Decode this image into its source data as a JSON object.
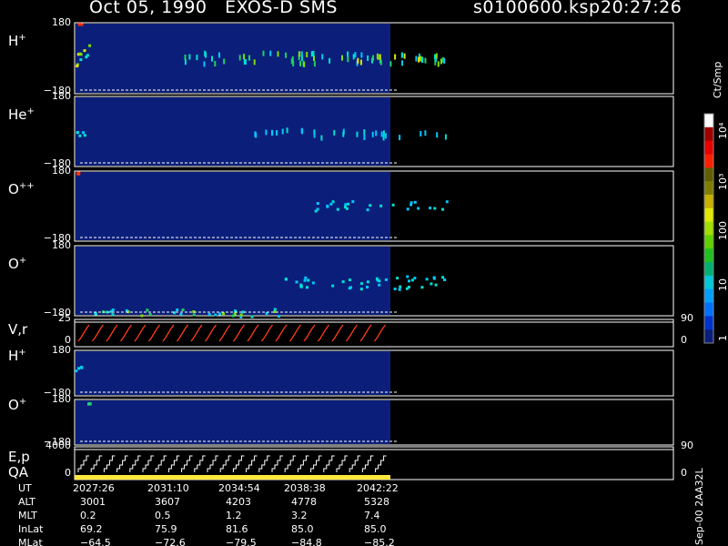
{
  "header": {
    "title": "Oct 05, 1990   EXOS-D SMS",
    "file": "s0100600.ksp",
    "time": "20:27:26"
  },
  "colors": {
    "background": "#000000",
    "panel_fill": "#0b1f7a",
    "dashed_line": "#ffffff",
    "velocity_trace": "#ff3a1a",
    "energy_trace": "#ffffff",
    "qa_bar": "#ffe83a"
  },
  "colorbar": {
    "unit_label": "Ct/Smp",
    "tick_labels": [
      "1",
      "10",
      "100",
      "10³",
      "10⁴"
    ],
    "colors": [
      "#0b1f7a",
      "#0033cc",
      "#0070ff",
      "#00a0ff",
      "#00c8d8",
      "#00b070",
      "#20c020",
      "#60d000",
      "#a0e000",
      "#e0e800",
      "#c8b000",
      "#808000",
      "#606000",
      "#ff2000",
      "#e80000",
      "#a00000",
      "#ffffff"
    ]
  },
  "side_label": "Sep-00 2AA32L",
  "chart_data": {
    "type": "heatmap",
    "title": "Oct 05, 1990   EXOS-D SMS",
    "time_axis_labels": [
      "2027:26",
      "2031:10",
      "2034:54",
      "2038:38",
      "2042:22"
    ],
    "data_extent": "2027:26 to ~2044:00 (plot continues empty to right)",
    "panels": [
      {
        "id": "h-plus-1",
        "label": "H",
        "charge": "+",
        "ylim": [
          -180,
          180
        ],
        "ytick_top": "180",
        "ytick_bottom": "−180",
        "features": [
          {
            "t": 0.0,
            "t2": 0.035,
            "y": [
              -40,
              80
            ],
            "level": "high",
            "note": "intense cluster at start"
          },
          {
            "t": 0.0,
            "t2": 0.01,
            "y": [
              175,
              180
            ],
            "level": "max",
            "note": "red/orange pixel at top"
          },
          {
            "t": 0.18,
            "t2": 0.62,
            "y": [
              -20,
              40
            ],
            "level": "medium",
            "note": "periodic vertical streaks, stronger later"
          },
          {
            "t": 0.45,
            "t2": 0.62,
            "y": [
              -10,
              30
            ],
            "level": "high",
            "note": "green-yellow pulses"
          }
        ]
      },
      {
        "id": "he-plus",
        "label": "He",
        "charge": "+",
        "ylim": [
          -180,
          180
        ],
        "ytick_top": "180",
        "ytick_bottom": "−180",
        "features": [
          {
            "t": 0.0,
            "t2": 0.02,
            "y": [
              -60,
              40
            ],
            "level": "low"
          },
          {
            "t": 0.3,
            "t2": 0.62,
            "y": [
              -20,
              20
            ],
            "level": "low",
            "note": "sparse cyan streaks"
          }
        ]
      },
      {
        "id": "o-plus-plus",
        "label": "O",
        "charge": "++",
        "ylim": [
          -180,
          180
        ],
        "ytick_top": "180",
        "ytick_bottom": "−180",
        "features": [
          {
            "t": 0.0,
            "t2": 0.01,
            "y": [
              170,
              180
            ],
            "level": "max",
            "note": "red pixel at top"
          },
          {
            "t": 0.4,
            "t2": 0.62,
            "y": [
              -20,
              30
            ],
            "level": "low"
          }
        ]
      },
      {
        "id": "o-plus-1",
        "label": "O",
        "charge": "+",
        "ylim": [
          -180,
          180
        ],
        "ytick_top": "180",
        "ytick_bottom": "−180",
        "features": [
          {
            "t": 0.0,
            "t2": 0.35,
            "y": [
              -180,
              -140
            ],
            "level": "medium",
            "note": "band near bottom"
          },
          {
            "t": 0.35,
            "t2": 0.62,
            "y": [
              -40,
              30
            ],
            "level": "low"
          }
        ]
      },
      {
        "id": "v-r",
        "label": "V,r",
        "type": "line",
        "ylim": [
          0,
          25
        ],
        "ytick_top": "25",
        "ytick_bottom": "0",
        "right_top": "90",
        "right_bottom": "0",
        "note": "repeating sawtooth velocity sweeps (red) from 0 to ~25"
      },
      {
        "id": "h-plus-2",
        "label": "H",
        "charge": "+",
        "ylim": [
          -180,
          180
        ],
        "ytick_top": "180",
        "ytick_bottom": "−180",
        "features": [
          {
            "t": 0.0,
            "t2": 0.01,
            "y": [
              20,
              60
            ],
            "level": "low"
          }
        ]
      },
      {
        "id": "o-plus-2",
        "label": "O",
        "charge": "+",
        "ylim": [
          -180,
          180
        ],
        "ytick_top": "180",
        "ytick_bottom": "−180",
        "features": [
          {
            "t": 0.02,
            "t2": 0.025,
            "y": [
              150,
              160
            ],
            "level": "high"
          }
        ]
      },
      {
        "id": "e-p",
        "label": "E,p",
        "label2": "QA",
        "type": "line",
        "ylim": [
          0,
          4000
        ],
        "ytick_top": "4000",
        "ytick_bottom": "0",
        "right_top": "90",
        "right_bottom": "0",
        "note": "white staircase energy sweeps, yellow QA bar beneath"
      }
    ],
    "ephemeris": [
      {
        "name": "UT",
        "values": [
          "2027:26",
          "2031:10",
          "2034:54",
          "2038:38",
          "2042:22"
        ]
      },
      {
        "name": "ALT",
        "values": [
          "3001",
          "3607",
          "4203",
          "4778",
          "5328"
        ]
      },
      {
        "name": "MLT",
        "values": [
          "0.2",
          "0.5",
          "1.2",
          "3.2",
          "7.4"
        ]
      },
      {
        "name": "InLat",
        "values": [
          "69.2",
          "75.9",
          "81.6",
          "85.0",
          "85.0"
        ]
      },
      {
        "name": "MLat",
        "values": [
          "−64.5",
          "−72.6",
          "−79.5",
          "−84.8",
          "−85.2"
        ]
      }
    ]
  }
}
